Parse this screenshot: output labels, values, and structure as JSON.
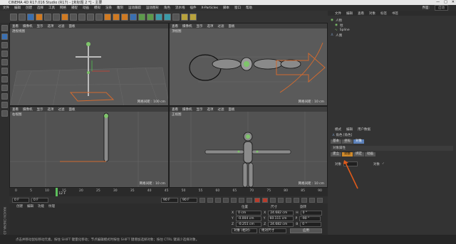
{
  "window": {
    "title": "CINEMA 4D R17.016 Studio (R17) - [未标题 2 *] - 主要",
    "min": "—",
    "max": "□",
    "close": "✕"
  },
  "menubar": {
    "items": [
      "文件",
      "编辑",
      "创建",
      "选择",
      "工具",
      "网格",
      "捕捉",
      "动画",
      "模拟",
      "渲染",
      "雕刻",
      "运动跟踪",
      "运动图形",
      "角色",
      "流水线",
      "插件",
      "X-Particles",
      "脚本",
      "窗口",
      "帮助"
    ],
    "layout_label": "界面:",
    "layout_value": "启动"
  },
  "viewports": {
    "menu": [
      "查看",
      "摄像机",
      "显示",
      "选项",
      "过滤",
      "面板"
    ],
    "perspective": {
      "name": "透视视图",
      "scale": "网格间距 : 100 cm"
    },
    "top": {
      "name": "顶视图",
      "scale": "网格间距 : 10 cm"
    },
    "right": {
      "name": "右视图",
      "scale": "网格间距 : 10 cm"
    },
    "front": {
      "name": "正视图",
      "scale": "网格间距 : 10 cm"
    }
  },
  "objects": {
    "menu": [
      "文件",
      "编辑",
      "查看",
      "对象",
      "标签",
      "书签"
    ],
    "rows": [
      {
        "name": "人物",
        "indent": 0
      },
      {
        "name": "柱",
        "indent": 1
      },
      {
        "name": "Spline",
        "indent": 1
      },
      {
        "name": "人偶",
        "indent": 0
      }
    ]
  },
  "attributes": {
    "menu": [
      "模式",
      "编辑",
      "用户数据"
    ],
    "object_label": "角色 [角色]",
    "tabs": [
      "基本",
      "坐标",
      "对象"
    ],
    "section_title": "对象属性",
    "subtabs": [
      "建立",
      "调整",
      "绑定",
      "动画"
    ],
    "active_subtab": "调整",
    "field_label": "对象",
    "field_value": "",
    "field_label2": "对象"
  },
  "timeline": {
    "ticks": [
      "0",
      "5",
      "10",
      "15",
      "20",
      "25",
      "30",
      "35",
      "40",
      "45",
      "50",
      "55",
      "60",
      "65",
      "70",
      "75",
      "80",
      "85",
      "90"
    ],
    "current_frame_label": "12 F",
    "progress": 0.133
  },
  "playbar": {
    "start": "0 F",
    "current": "0 F",
    "end": "90 F",
    "end2": "90 F"
  },
  "material": {
    "menu": [
      "创建",
      "编辑",
      "功能",
      "纹理"
    ]
  },
  "coordinates": {
    "headers": [
      "位置",
      "尺寸",
      "旋转"
    ],
    "rows": [
      {
        "axis": "X",
        "pos": "0 cm",
        "size": "24.682 cm",
        "rot_label": "H",
        "rot": "0 °"
      },
      {
        "axis": "Y",
        "pos": "-0.004 cm",
        "size": "60.111 cm",
        "rot_label": "P",
        "rot": "-90 °"
      },
      {
        "axis": "Z",
        "pos": "-0.251 cm",
        "size": "24.682 cm",
        "rot_label": "B",
        "rot": "0 °"
      }
    ],
    "mode1": "对象 (相对)",
    "mode2": "绝对尺寸",
    "apply": "应用"
  },
  "status": {
    "text": "点击并移动鼠标移动元素。按住 SHIFT 键量化移动；节点编辑模式时按住 SHIFT 键增加选择对象；按住 CTRL 键减少选择对象。"
  },
  "brand": {
    "maxon": "MAXON CINEMA 4D"
  },
  "colors": {
    "accent_orange": "#d07a22",
    "active_blue": "#5a7fb8",
    "x_axis": "#d04030",
    "y_axis": "#50c050",
    "z_axis": "#3060d0"
  }
}
